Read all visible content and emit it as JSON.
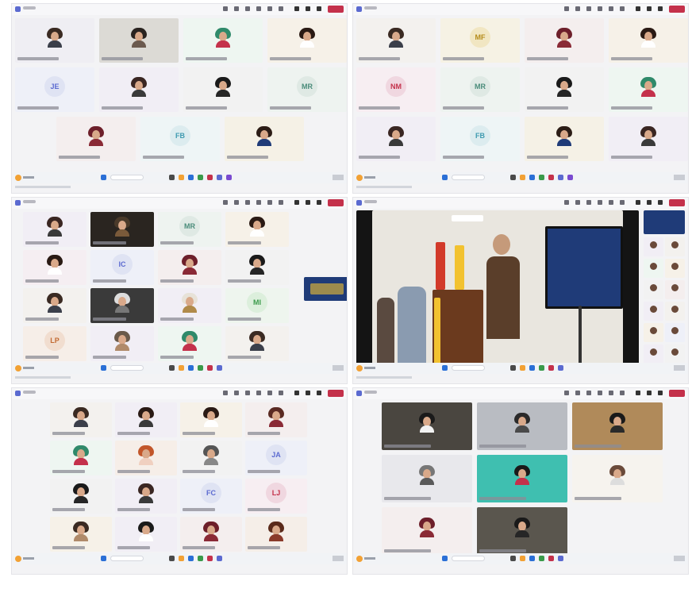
{
  "colors": {
    "teams_purple": "#5b6ad0",
    "leave_red": "#c4314b",
    "window_bg": "#f3f3f5",
    "taskbar": "#f1f3f6"
  },
  "panels": [
    {
      "id": "tl",
      "tiles": [
        {
          "t": "photo",
          "bg": "#efeef3",
          "hair": "#3a2a22",
          "shirt": "#3b3f4a"
        },
        {
          "t": "photo",
          "bg": "#dcdad5",
          "hair": "#2a2320",
          "shirt": "#6b5a4f"
        },
        {
          "t": "photo",
          "bg": "#eef6f1",
          "hair": "#2f8a6a",
          "shirt": "#c4314b"
        },
        {
          "t": "photo",
          "bg": "#f6f1e8",
          "hair": "#2a1a14",
          "shirt": "#ffffff"
        },
        {
          "t": "ini",
          "label": "JE",
          "bg": "#eef0f8",
          "circ": "#dfe3f3",
          "fg": "#5b6ad0"
        },
        {
          "t": "photo",
          "bg": "#f1eef5",
          "hair": "#3a2622",
          "shirt": "#3a3a3a"
        },
        {
          "t": "photo",
          "bg": "#f2f2f2",
          "hair": "#1a1a1a",
          "shirt": "#262626"
        },
        {
          "t": "ini",
          "label": "MR",
          "bg": "#eef3f0",
          "circ": "#dfe9e4",
          "fg": "#4a8c7a"
        },
        {
          "t": "photo",
          "bg": "#f4eeee",
          "hair": "#6d1f2a",
          "shirt": "#8a2a36"
        },
        {
          "t": "ini",
          "label": "FB",
          "bg": "#eef5f6",
          "circ": "#dcecef",
          "fg": "#3f9bb0"
        },
        {
          "t": "photo",
          "bg": "#f5f1e6",
          "hair": "#2c1d16",
          "shirt": "#1f3b78"
        }
      ]
    },
    {
      "id": "tr",
      "tiles": [
        {
          "t": "photo",
          "bg": "#f3f1ee",
          "hair": "#3a2a22",
          "shirt": "#3b3f4a"
        },
        {
          "t": "ini",
          "label": "MF",
          "bg": "#f6f2e4",
          "circ": "#f1e6c2",
          "fg": "#b58b1b"
        },
        {
          "t": "photo",
          "bg": "#f4eeee",
          "hair": "#6d1f2a",
          "shirt": "#8a2a36"
        },
        {
          "t": "photo",
          "bg": "#f6f1e8",
          "hair": "#2a1a14",
          "shirt": "#ffffff"
        },
        {
          "t": "ini",
          "label": "NM",
          "bg": "#f7eef2",
          "circ": "#f0d7e0",
          "fg": "#c4314b"
        },
        {
          "t": "ini",
          "label": "MR",
          "bg": "#eef3f0",
          "circ": "#dfe9e4",
          "fg": "#4a8c7a"
        },
        {
          "t": "photo",
          "bg": "#f2f2f2",
          "hair": "#1a1a1a",
          "shirt": "#262626"
        },
        {
          "t": "photo",
          "bg": "#eef6f1",
          "hair": "#2f8a6a",
          "shirt": "#c4314b"
        },
        {
          "t": "photo",
          "bg": "#f1eef5",
          "hair": "#3a2622",
          "shirt": "#3a3a3a"
        },
        {
          "t": "ini",
          "label": "FB",
          "bg": "#eef5f6",
          "circ": "#dcecef",
          "fg": "#3f9bb0"
        },
        {
          "t": "photo",
          "bg": "#f5f1e6",
          "hair": "#2c1d16",
          "shirt": "#1f3b78"
        },
        {
          "t": "photo",
          "bg": "#f1eef5",
          "hair": "#3a2622",
          "shirt": "#3a3a3a"
        }
      ]
    },
    {
      "id": "ml",
      "tiles": [
        {
          "t": "photo",
          "bg": "#f1eef5",
          "hair": "#3a2622",
          "shirt": "#3a3a3a"
        },
        {
          "t": "photo",
          "bg": "#2a2520",
          "hair": "#4a3a2a",
          "shirt": "#7a5a3a"
        },
        {
          "t": "ini",
          "label": "MR",
          "bg": "#eef3f0",
          "circ": "#dfe9e4",
          "fg": "#4a8c7a"
        },
        {
          "t": "photo",
          "bg": "#f6f1e8",
          "hair": "#2a1a14",
          "shirt": "#ffffff"
        },
        {
          "t": "photo",
          "bg": "#f5eef2",
          "hair": "#2a1a14",
          "shirt": "#ffffff"
        },
        {
          "t": "ini",
          "label": "IC",
          "bg": "#eef0f8",
          "circ": "#dfe3f3",
          "fg": "#5b6ad0"
        },
        {
          "t": "photo",
          "bg": "#f4eeee",
          "hair": "#6d1f2a",
          "shirt": "#8a2a36"
        },
        {
          "t": "photo",
          "bg": "#f2f2f2",
          "hair": "#1a1a1a",
          "shirt": "#262626"
        },
        {
          "t": "photo",
          "bg": "#f3f1ee",
          "hair": "#3a2a22",
          "shirt": "#3b3f4a"
        },
        {
          "t": "photo",
          "bg": "#3a3a3a",
          "hair": "#dddddd",
          "shirt": "#777777"
        },
        {
          "t": "photo",
          "bg": "#f1eef5",
          "hair": "#e7e2d8",
          "shirt": "#b08a4a"
        },
        {
          "t": "ini",
          "label": "MI",
          "bg": "#eef5ee",
          "circ": "#dcefdc",
          "fg": "#3a9a4a"
        },
        {
          "t": "ini",
          "label": "LP",
          "bg": "#f6eee8",
          "circ": "#f1ddcf",
          "fg": "#c26a32"
        },
        {
          "t": "photo",
          "bg": "#f1eef5",
          "hair": "#6a5a4a",
          "shirt": "#b08a6a"
        },
        {
          "t": "photo",
          "bg": "#eef6f1",
          "hair": "#2f8a6a",
          "shirt": "#c4314b"
        },
        {
          "t": "photo",
          "bg": "#f3f1ee",
          "hair": "#3a2a22",
          "shirt": "#3b3f4a"
        }
      ]
    },
    {
      "id": "bl",
      "tiles": [
        {
          "t": "photo",
          "bg": "#f3f1ee",
          "hair": "#3a2a22",
          "shirt": "#3b3f4a"
        },
        {
          "t": "photo",
          "bg": "#f1eef5",
          "hair": "#2a1a14",
          "shirt": "#3a3a3a"
        },
        {
          "t": "photo",
          "bg": "#f6f1e8",
          "hair": "#2a1a14",
          "shirt": "#ffffff"
        },
        {
          "t": "photo",
          "bg": "#f4eeee",
          "hair": "#5a2a22",
          "shirt": "#8a2a36"
        },
        {
          "t": "photo",
          "bg": "#eef6f1",
          "hair": "#2f8a6a",
          "shirt": "#c4314b"
        },
        {
          "t": "photo",
          "bg": "#f6eee8",
          "hair": "#c2562a",
          "shirt": "#f0d0c0"
        },
        {
          "t": "photo",
          "bg": "#f2f2f2",
          "hair": "#555555",
          "shirt": "#888888"
        },
        {
          "t": "ini",
          "label": "JA",
          "bg": "#eef0f8",
          "circ": "#dfe3f3",
          "fg": "#5b6ad0"
        },
        {
          "t": "photo",
          "bg": "#f2f2f2",
          "hair": "#1a1a1a",
          "shirt": "#262626"
        },
        {
          "t": "photo",
          "bg": "#f1eef5",
          "hair": "#3a2622",
          "shirt": "#3a3a3a"
        },
        {
          "t": "ini",
          "label": "FC",
          "bg": "#eef0f8",
          "circ": "#dfe3f3",
          "fg": "#5b6ad0"
        },
        {
          "t": "ini",
          "label": "LJ",
          "bg": "#f7eef2",
          "circ": "#f0d7e0",
          "fg": "#c4314b"
        },
        {
          "t": "photo",
          "bg": "#f6f1e8",
          "hair": "#3a2a22",
          "shirt": "#b08a6a"
        },
        {
          "t": "photo",
          "bg": "#f1eef5",
          "hair": "#1a1a1a",
          "shirt": "#ffffff"
        },
        {
          "t": "photo",
          "bg": "#f4eeee",
          "hair": "#6d1f2a",
          "shirt": "#8a2a36"
        },
        {
          "t": "photo",
          "bg": "#f5eee8",
          "hair": "#5a2a1a",
          "shirt": "#8a3a2a"
        }
      ]
    },
    {
      "id": "br",
      "tiles": [
        {
          "t": "photo",
          "bg": "#4a4640",
          "hair": "#1a1a1a",
          "shirt": "#f2f2f2"
        },
        {
          "t": "photo",
          "bg": "#b9bcc2",
          "hair": "#2a2a2a",
          "shirt": "#4a4a4a"
        },
        {
          "t": "photo",
          "bg": "#b08a5a",
          "hair": "#1a1a1a",
          "shirt": "#2a2a2a"
        },
        {
          "t": "photo",
          "bg": "#e8e8ec",
          "hair": "#777777",
          "shirt": "#5a5a5a"
        },
        {
          "t": "photo",
          "bg": "#3fbfb0",
          "hair": "#1a1a1a",
          "shirt": "#c4314b"
        },
        {
          "t": "photo",
          "bg": "#f6f3ee",
          "hair": "#6a4a3a",
          "shirt": "#dddddd"
        },
        {
          "t": "photo",
          "bg": "#f4eeee",
          "hair": "#6d1f2a",
          "shirt": "#8a2a36"
        },
        {
          "t": "photo",
          "bg": "#5a564e",
          "hair": "#1a1a1a",
          "shirt": "#262626"
        }
      ]
    }
  ]
}
